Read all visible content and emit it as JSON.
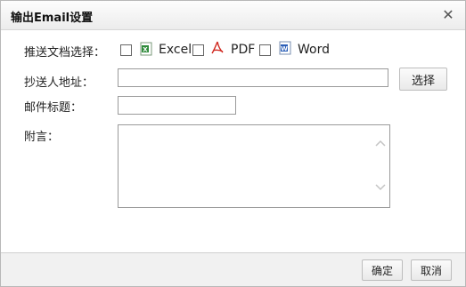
{
  "dialog": {
    "title": "输出Email设置"
  },
  "form": {
    "doc_label": "推送文档选择：",
    "formats": [
      {
        "label": "Excel",
        "icon": "excel-icon",
        "checked": false
      },
      {
        "label": "PDF",
        "icon": "pdf-icon",
        "checked": false
      },
      {
        "label": "Word",
        "icon": "word-icon",
        "checked": false
      }
    ],
    "cc_label": "抄送人地址：",
    "cc_value": "",
    "select_label": "选择",
    "subject_label": "邮件标题：",
    "subject_value": "",
    "note_label": "附言：",
    "note_value": ""
  },
  "footer": {
    "ok_label": "确定",
    "cancel_label": "取消"
  },
  "colors": {
    "excel": "#2e8b3a",
    "pdf": "#d0281f",
    "word": "#2b5fb8"
  }
}
